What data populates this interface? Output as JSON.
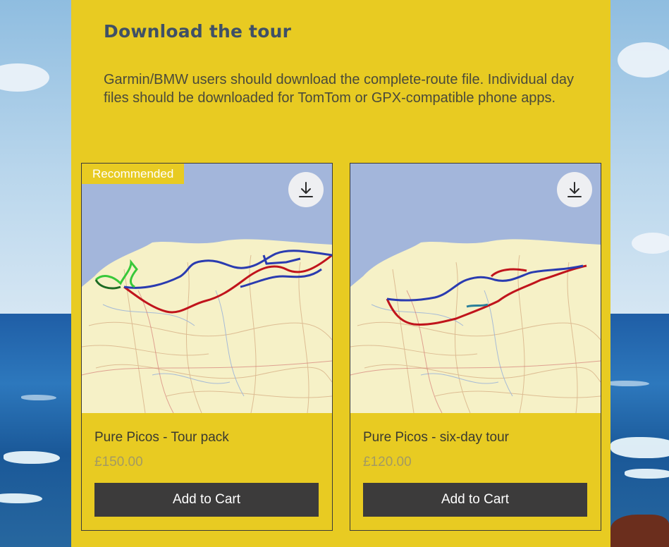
{
  "section": {
    "heading": "Download the tour",
    "intro": "Garmin/BMW users should download the complete-route file. Individual day files should be downloaded for TomTom or GPX-compatible phone apps."
  },
  "products": [
    {
      "badge": "Recommended",
      "name": "Pure Picos - Tour pack",
      "price": "£150.00",
      "cta": "Add to Cart",
      "icon": "download-icon"
    },
    {
      "name": "Pure Picos - six-day tour",
      "price": "£120.00",
      "cta": "Add to Cart",
      "icon": "download-icon"
    }
  ],
  "colors": {
    "panel": "#e8cb22",
    "heading": "#3f5066",
    "button": "#3c3b3b",
    "route_red": "#c0141c",
    "route_blue": "#2a3bb0",
    "route_green": "#38c83a"
  }
}
